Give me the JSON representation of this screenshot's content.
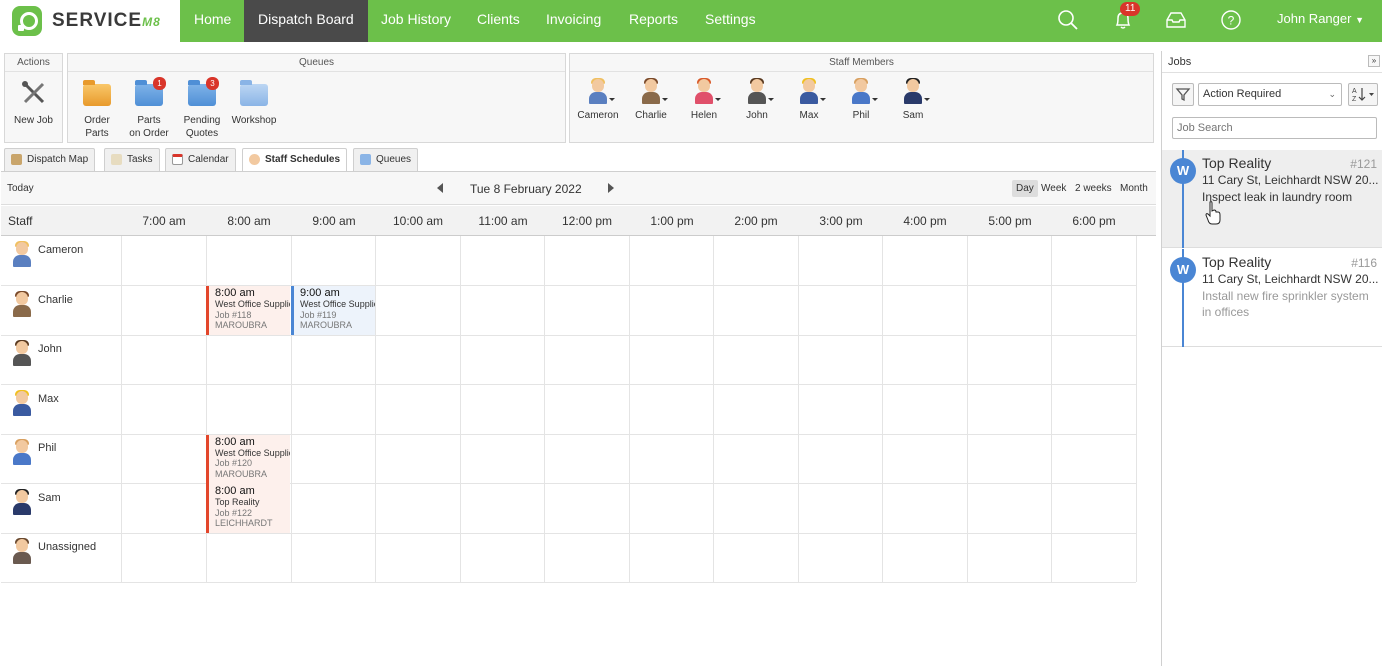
{
  "app": {
    "logo_text": "SERVICE",
    "logo_suffix": "M8"
  },
  "nav": {
    "items": [
      "Home",
      "Dispatch Board",
      "Job History",
      "Clients",
      "Invoicing",
      "Reports",
      "Settings"
    ],
    "active": "Dispatch Board",
    "notification_count": "11",
    "user": "John Ranger"
  },
  "toolbar": {
    "actions_title": "Actions",
    "new_job": "New Job",
    "queues_title": "Queues",
    "queues": [
      {
        "line1": "Order",
        "line2": "Parts",
        "badge": ""
      },
      {
        "line1": "Parts",
        "line2": "on Order",
        "badge": "1"
      },
      {
        "line1": "Pending",
        "line2": "Quotes",
        "badge": "3"
      },
      {
        "line1": "Workshop",
        "line2": "",
        "badge": ""
      }
    ],
    "staff_title": "Staff Members",
    "staff": [
      "Cameron",
      "Charlie",
      "Helen",
      "John",
      "Max",
      "Phil",
      "Sam"
    ]
  },
  "tabs": [
    "Dispatch Map",
    "Tasks",
    "Calendar",
    "Staff Schedules",
    "Queues"
  ],
  "active_tab": "Staff Schedules",
  "schedule": {
    "today": "Today",
    "date": "Tue 8 February 2022",
    "views": [
      "Day",
      "Week",
      "2 weeks",
      "Month"
    ],
    "active_view": "Day",
    "staff_header": "Staff",
    "hours": [
      "7:00 am",
      "8:00 am",
      "9:00 am",
      "10:00 am",
      "11:00 am",
      "12:00 pm",
      "1:00 pm",
      "2:00 pm",
      "3:00 pm",
      "4:00 pm",
      "5:00 pm",
      "6:00 pm"
    ],
    "rows": [
      "Cameron",
      "Charlie",
      "John",
      "Max",
      "Phil",
      "Sam",
      "Unassigned"
    ],
    "jobs": [
      {
        "staff": "Charlie",
        "time": "8:00 am",
        "title": "West Office Supplies",
        "job": "Job #118",
        "suburb": "MAROUBRA",
        "color": "#e3462b"
      },
      {
        "staff": "Charlie",
        "time": "9:00 am",
        "title": "West Office Supplies",
        "job": "Job #119",
        "suburb": "MAROUBRA",
        "color": "#4a86d4"
      },
      {
        "staff": "Phil",
        "time": "8:00 am",
        "title": "West Office Supplies",
        "job": "Job #120",
        "suburb": "MAROUBRA",
        "color": "#e3462b"
      },
      {
        "staff": "Sam",
        "time": "8:00 am",
        "title": "Top Reality",
        "job": "Job #122",
        "suburb": "LEICHHARDT",
        "color": "#e3462b"
      }
    ]
  },
  "jobs_panel": {
    "title": "Jobs",
    "filter_value": "Action Required",
    "search_placeholder": "Job Search",
    "cards": [
      {
        "initial": "W",
        "client": "Top Reality",
        "number": "#121",
        "address": "11 Cary St, Leichhardt NSW 20...",
        "description": "Inspect leak in laundry room"
      },
      {
        "initial": "W",
        "client": "Top Reality",
        "number": "#116",
        "address": "11 Cary St, Leichhardt NSW 20...",
        "description": "Install new fire sprinkler system in offices"
      }
    ]
  },
  "colors": {
    "brand_green": "#6cc04a",
    "nav_active": "#4a4a4a",
    "job_red": "#e3462b",
    "job_blue": "#4a86d4",
    "badge_red": "#d9352a"
  }
}
